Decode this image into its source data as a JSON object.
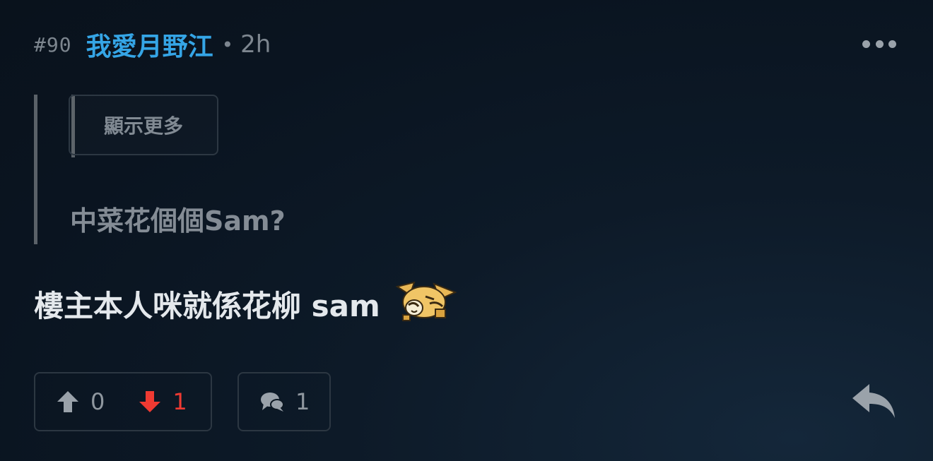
{
  "post": {
    "floor": "#90",
    "username": "我愛月野江",
    "separator": "•",
    "time": "2h",
    "quote": {
      "show_more_label": "顯示更多",
      "text": "中菜花個個Sam?"
    },
    "body": "樓主本人咪就係花柳 sam",
    "emoji_icon": "laughing-dog-emoji-icon"
  },
  "actions": {
    "upvotes": "0",
    "downvotes": "1",
    "comments": "1"
  },
  "colors": {
    "username": "#35a5e6",
    "downvote": "#ef3a32",
    "muted": "#7d868f",
    "border": "#2c3742"
  }
}
